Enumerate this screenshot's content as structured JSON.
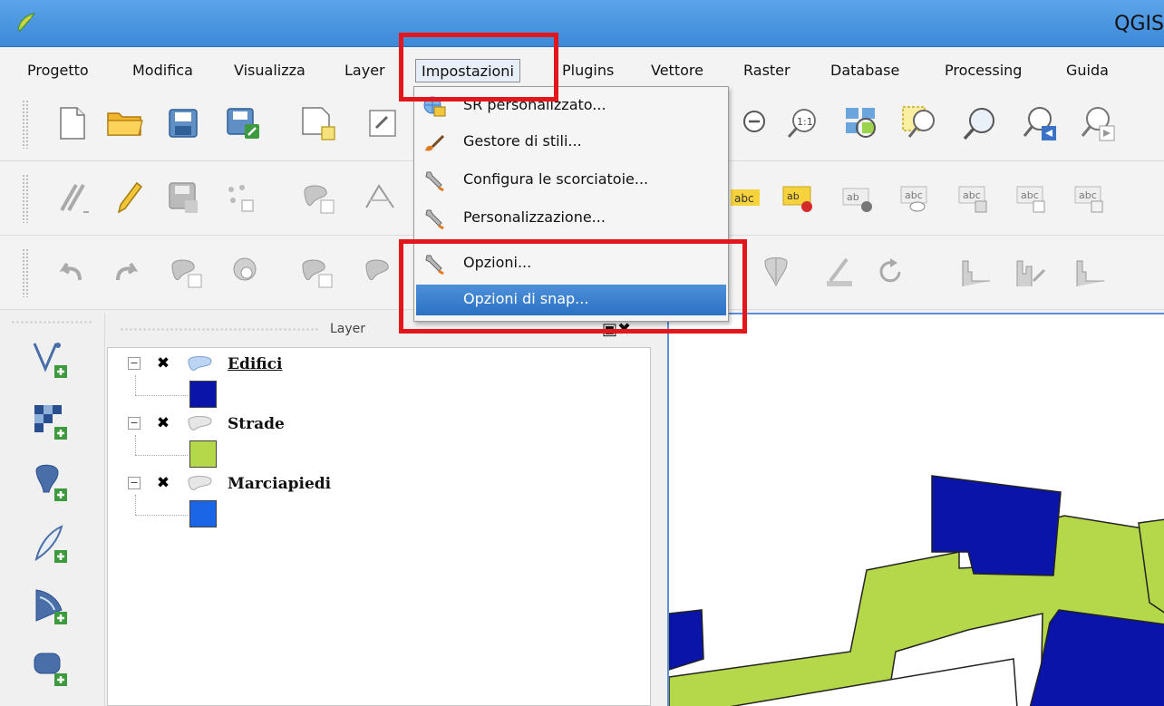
{
  "window": {
    "title": "QGIS"
  },
  "menubar": {
    "items": [
      "Progetto",
      "Modifica",
      "Visualizza",
      "Layer",
      "Impostazioni",
      "Plugins",
      "Vettore",
      "Raster",
      "Database",
      "Processing",
      "Guida"
    ],
    "active": "Impostazioni"
  },
  "settings_menu": {
    "items": [
      {
        "label": "SR personalizzato...",
        "icon": "crs-globe-icon"
      },
      {
        "label": "Gestore di stili...",
        "icon": "style-brush-icon"
      },
      {
        "label": "Configura le scorciatoie...",
        "icon": "wrench-icon"
      },
      {
        "label": "Personalizzazione...",
        "icon": "wrench-icon"
      },
      {
        "label": "Opzioni...",
        "icon": "wrench-icon"
      },
      {
        "label": "Opzioni di snap...",
        "icon": "",
        "highlighted": true
      }
    ]
  },
  "layers_panel": {
    "title": "Layer",
    "layers": [
      {
        "name": "Edifici",
        "checked": true,
        "swatch_color": "#0a14a8",
        "underlined": true
      },
      {
        "name": "Strade",
        "checked": true,
        "swatch_color": "#b4d84a"
      },
      {
        "name": "Marciapiedi",
        "checked": true,
        "swatch_color": "#1a66e6"
      }
    ]
  },
  "colors": {
    "titlebar": "#3d89d8",
    "highlight": "#2c72c4",
    "annotation_red": "#e3161b",
    "road_green": "#b4d84a",
    "building_blue": "#0a14a8"
  }
}
